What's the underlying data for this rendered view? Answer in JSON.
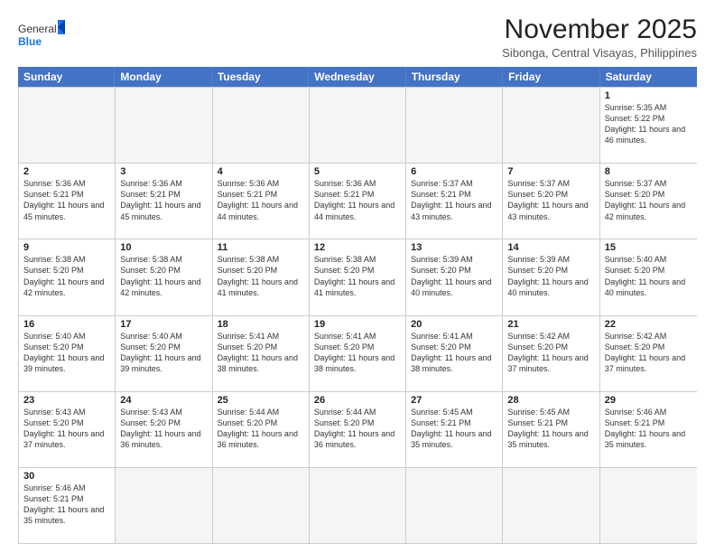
{
  "header": {
    "logo_general": "General",
    "logo_blue": "Blue",
    "title": "November 2025",
    "subtitle": "Sibonga, Central Visayas, Philippines"
  },
  "days_of_week": [
    "Sunday",
    "Monday",
    "Tuesday",
    "Wednesday",
    "Thursday",
    "Friday",
    "Saturday"
  ],
  "weeks": [
    [
      {
        "day": "",
        "content": ""
      },
      {
        "day": "",
        "content": ""
      },
      {
        "day": "",
        "content": ""
      },
      {
        "day": "",
        "content": ""
      },
      {
        "day": "",
        "content": ""
      },
      {
        "day": "",
        "content": ""
      },
      {
        "day": "1",
        "content": "Sunrise: 5:35 AM\nSunset: 5:22 PM\nDaylight: 11 hours\nand 46 minutes."
      }
    ],
    [
      {
        "day": "2",
        "content": "Sunrise: 5:36 AM\nSunset: 5:21 PM\nDaylight: 11 hours\nand 45 minutes."
      },
      {
        "day": "3",
        "content": "Sunrise: 5:36 AM\nSunset: 5:21 PM\nDaylight: 11 hours\nand 45 minutes."
      },
      {
        "day": "4",
        "content": "Sunrise: 5:36 AM\nSunset: 5:21 PM\nDaylight: 11 hours\nand 44 minutes."
      },
      {
        "day": "5",
        "content": "Sunrise: 5:36 AM\nSunset: 5:21 PM\nDaylight: 11 hours\nand 44 minutes."
      },
      {
        "day": "6",
        "content": "Sunrise: 5:37 AM\nSunset: 5:21 PM\nDaylight: 11 hours\nand 43 minutes."
      },
      {
        "day": "7",
        "content": "Sunrise: 5:37 AM\nSunset: 5:20 PM\nDaylight: 11 hours\nand 43 minutes."
      },
      {
        "day": "8",
        "content": "Sunrise: 5:37 AM\nSunset: 5:20 PM\nDaylight: 11 hours\nand 42 minutes."
      }
    ],
    [
      {
        "day": "9",
        "content": "Sunrise: 5:38 AM\nSunset: 5:20 PM\nDaylight: 11 hours\nand 42 minutes."
      },
      {
        "day": "10",
        "content": "Sunrise: 5:38 AM\nSunset: 5:20 PM\nDaylight: 11 hours\nand 42 minutes."
      },
      {
        "day": "11",
        "content": "Sunrise: 5:38 AM\nSunset: 5:20 PM\nDaylight: 11 hours\nand 41 minutes."
      },
      {
        "day": "12",
        "content": "Sunrise: 5:38 AM\nSunset: 5:20 PM\nDaylight: 11 hours\nand 41 minutes."
      },
      {
        "day": "13",
        "content": "Sunrise: 5:39 AM\nSunset: 5:20 PM\nDaylight: 11 hours\nand 40 minutes."
      },
      {
        "day": "14",
        "content": "Sunrise: 5:39 AM\nSunset: 5:20 PM\nDaylight: 11 hours\nand 40 minutes."
      },
      {
        "day": "15",
        "content": "Sunrise: 5:40 AM\nSunset: 5:20 PM\nDaylight: 11 hours\nand 40 minutes."
      }
    ],
    [
      {
        "day": "16",
        "content": "Sunrise: 5:40 AM\nSunset: 5:20 PM\nDaylight: 11 hours\nand 39 minutes."
      },
      {
        "day": "17",
        "content": "Sunrise: 5:40 AM\nSunset: 5:20 PM\nDaylight: 11 hours\nand 39 minutes."
      },
      {
        "day": "18",
        "content": "Sunrise: 5:41 AM\nSunset: 5:20 PM\nDaylight: 11 hours\nand 38 minutes."
      },
      {
        "day": "19",
        "content": "Sunrise: 5:41 AM\nSunset: 5:20 PM\nDaylight: 11 hours\nand 38 minutes."
      },
      {
        "day": "20",
        "content": "Sunrise: 5:41 AM\nSunset: 5:20 PM\nDaylight: 11 hours\nand 38 minutes."
      },
      {
        "day": "21",
        "content": "Sunrise: 5:42 AM\nSunset: 5:20 PM\nDaylight: 11 hours\nand 37 minutes."
      },
      {
        "day": "22",
        "content": "Sunrise: 5:42 AM\nSunset: 5:20 PM\nDaylight: 11 hours\nand 37 minutes."
      }
    ],
    [
      {
        "day": "23",
        "content": "Sunrise: 5:43 AM\nSunset: 5:20 PM\nDaylight: 11 hours\nand 37 minutes."
      },
      {
        "day": "24",
        "content": "Sunrise: 5:43 AM\nSunset: 5:20 PM\nDaylight: 11 hours\nand 36 minutes."
      },
      {
        "day": "25",
        "content": "Sunrise: 5:44 AM\nSunset: 5:20 PM\nDaylight: 11 hours\nand 36 minutes."
      },
      {
        "day": "26",
        "content": "Sunrise: 5:44 AM\nSunset: 5:20 PM\nDaylight: 11 hours\nand 36 minutes."
      },
      {
        "day": "27",
        "content": "Sunrise: 5:45 AM\nSunset: 5:21 PM\nDaylight: 11 hours\nand 35 minutes."
      },
      {
        "day": "28",
        "content": "Sunrise: 5:45 AM\nSunset: 5:21 PM\nDaylight: 11 hours\nand 35 minutes."
      },
      {
        "day": "29",
        "content": "Sunrise: 5:46 AM\nSunset: 5:21 PM\nDaylight: 11 hours\nand 35 minutes."
      }
    ],
    [
      {
        "day": "30",
        "content": "Sunrise: 5:46 AM\nSunset: 5:21 PM\nDaylight: 11 hours\nand 35 minutes."
      },
      {
        "day": "",
        "content": ""
      },
      {
        "day": "",
        "content": ""
      },
      {
        "day": "",
        "content": ""
      },
      {
        "day": "",
        "content": ""
      },
      {
        "day": "",
        "content": ""
      },
      {
        "day": "",
        "content": ""
      }
    ]
  ]
}
